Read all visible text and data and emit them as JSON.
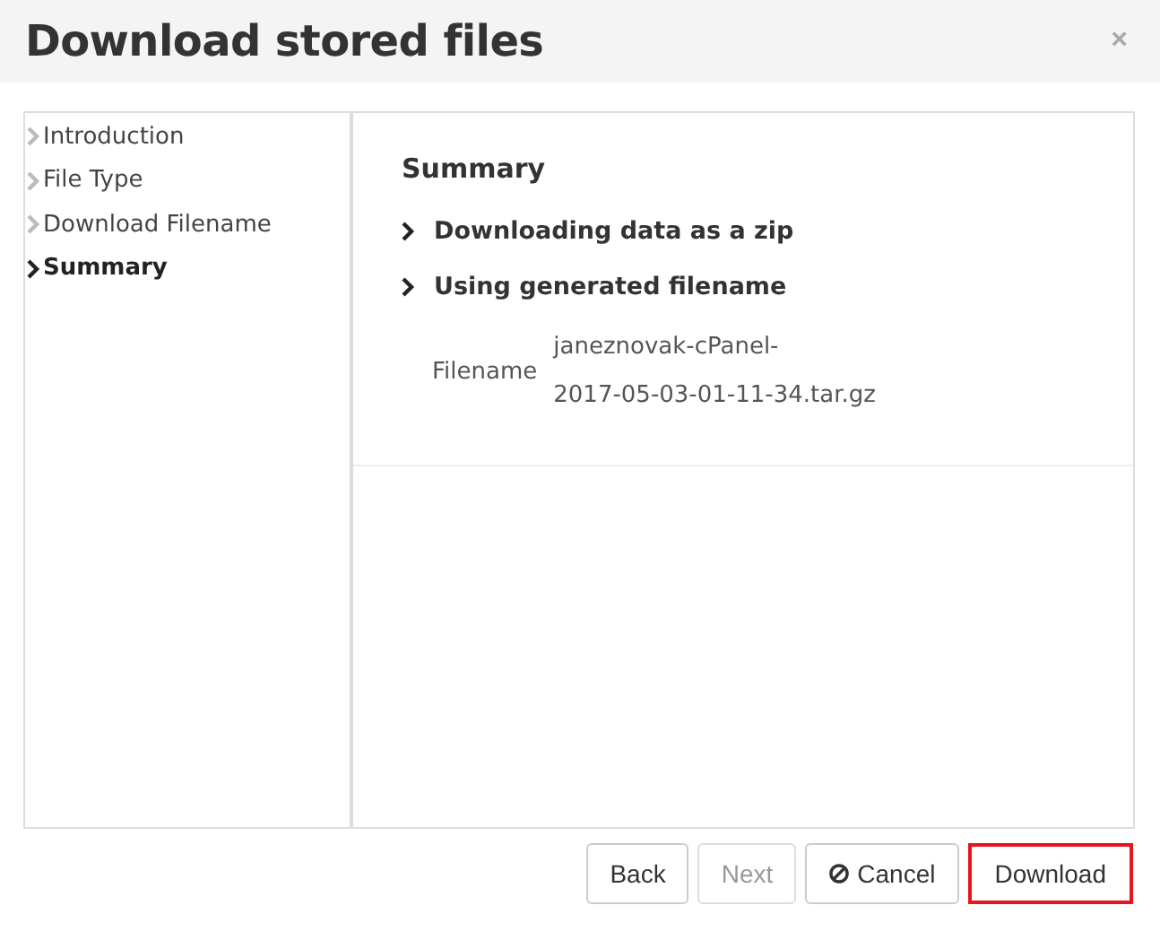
{
  "window": {
    "title": "Download stored files",
    "close": "×"
  },
  "steps": [
    {
      "label": "Introduction",
      "selected": false
    },
    {
      "label": "File Type",
      "selected": false
    },
    {
      "label": "Download Filename",
      "selected": false
    },
    {
      "label": "Summary",
      "selected": true
    }
  ],
  "summary": {
    "heading": "Summary",
    "items": [
      "Downloading data as a zip",
      "Using generated filename"
    ],
    "field_label": "Filename",
    "field_value_lines": [
      "janeznovak-cPanel-",
      "2017-05-03-01-11-34.tar.gz"
    ]
  },
  "buttons": [
    {
      "label": "Back",
      "kind": "plain",
      "disabled": false,
      "highlighted": false
    },
    {
      "label": "Next",
      "kind": "plain",
      "disabled": true,
      "highlighted": false
    },
    {
      "label": "Cancel",
      "kind": "cancel",
      "disabled": false,
      "highlighted": false
    },
    {
      "label": "Download",
      "kind": "plain",
      "disabled": false,
      "highlighted": true
    }
  ]
}
